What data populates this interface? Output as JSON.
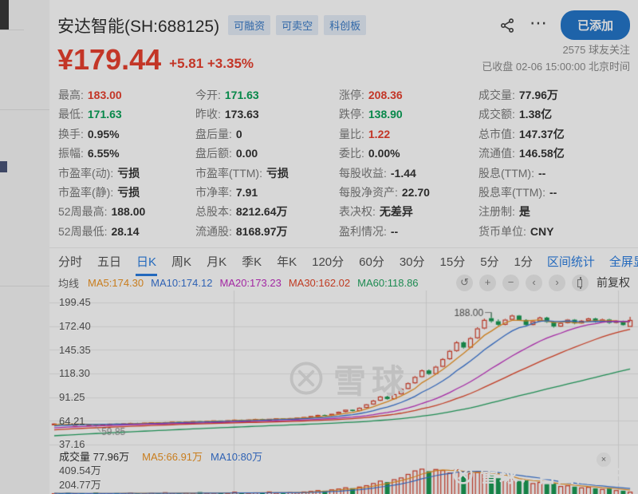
{
  "header": {
    "title": "安达智能(SH:688125)",
    "badges": [
      "可融资",
      "可卖空",
      "科创板"
    ],
    "more_icon": "⋯",
    "added_button": "已添加"
  },
  "quote": {
    "price": "¥179.44",
    "change": "+5.81 +3.35%",
    "followers": "2575 球友关注",
    "status": "已收盘 02-06 15:00:00 北京时间"
  },
  "stats": {
    "columns": [
      [
        {
          "l": "最高:",
          "v": "183.00",
          "c": "red"
        },
        {
          "l": "最低:",
          "v": "171.63",
          "c": "green"
        },
        {
          "l": "换手:",
          "v": "0.95%"
        },
        {
          "l": "振幅:",
          "v": "6.55%"
        },
        {
          "l": "市盈率(动):",
          "v": "亏损"
        },
        {
          "l": "市盈率(静):",
          "v": "亏损"
        },
        {
          "l": "52周最高:",
          "v": "188.00"
        },
        {
          "l": "52周最低:",
          "v": "28.14"
        }
      ],
      [
        {
          "l": "今开:",
          "v": "171.63",
          "c": "green"
        },
        {
          "l": "昨收:",
          "v": "173.63"
        },
        {
          "l": "盘后量:",
          "v": "0"
        },
        {
          "l": "盘后额:",
          "v": "0.00"
        },
        {
          "l": "市盈率(TTM):",
          "v": "亏损"
        },
        {
          "l": "市净率:",
          "v": "7.91"
        },
        {
          "l": "总股本:",
          "v": "8212.64万"
        },
        {
          "l": "流通股:",
          "v": "8168.97万"
        }
      ],
      [
        {
          "l": "涨停:",
          "v": "208.36",
          "c": "red"
        },
        {
          "l": "跌停:",
          "v": "138.90",
          "c": "green"
        },
        {
          "l": "量比:",
          "v": "1.22",
          "c": "red"
        },
        {
          "l": "委比:",
          "v": "0.00%"
        },
        {
          "l": "每股收益:",
          "v": "-1.44"
        },
        {
          "l": "每股净资产:",
          "v": "22.70"
        },
        {
          "l": "表决权:",
          "v": "无差异"
        },
        {
          "l": "盈利情况:",
          "v": "--"
        }
      ],
      [
        {
          "l": "成交量:",
          "v": "77.96万"
        },
        {
          "l": "成交额:",
          "v": "1.38亿"
        },
        {
          "l": "总市值:",
          "v": "147.37亿"
        },
        {
          "l": "流通值:",
          "v": "146.58亿"
        },
        {
          "l": "股息(TTM):",
          "v": "--"
        },
        {
          "l": "股息率(TTM):",
          "v": "--"
        },
        {
          "l": "注册制:",
          "v": "是"
        },
        {
          "l": "货币单位:",
          "v": "CNY"
        }
      ]
    ]
  },
  "tabs": {
    "items": [
      {
        "label": "分时"
      },
      {
        "label": "五日"
      },
      {
        "label": "日K",
        "cls": "active"
      },
      {
        "label": "周K"
      },
      {
        "label": "月K"
      },
      {
        "label": "季K"
      },
      {
        "label": "年K"
      },
      {
        "label": "120分"
      },
      {
        "label": "60分"
      },
      {
        "label": "30分"
      },
      {
        "label": "15分"
      },
      {
        "label": "5分"
      },
      {
        "label": "1分"
      }
    ],
    "links": [
      "区间统计",
      "全屏显示"
    ]
  },
  "toolbar": {
    "ma_title": "均线",
    "ma_items": [
      {
        "text": "MA5:174.30",
        "color": "#ee9524"
      },
      {
        "text": "MA10:174.12",
        "color": "#3875d6"
      },
      {
        "text": "MA20:173.23",
        "color": "#c22fc2"
      },
      {
        "text": "MA30:162.02",
        "color": "#e44629"
      },
      {
        "text": "MA60:118.86",
        "color": "#24a562"
      }
    ],
    "buttons": [
      {
        "name": "undo-icon",
        "glyph": "↺"
      },
      {
        "name": "zoom-in-icon",
        "glyph": "+"
      },
      {
        "name": "zoom-out-icon",
        "glyph": "−"
      },
      {
        "name": "pan-left-icon",
        "glyph": "‹"
      },
      {
        "name": "pan-right-icon",
        "glyph": "›"
      },
      {
        "name": "candle-style-icon",
        "glyph": "",
        "cls": "icon-candle"
      }
    ],
    "adjust": "前复权"
  },
  "watermarks": {
    "center": "雪球",
    "bottom_right": "雪球：自由的张三",
    "close_icon": "×"
  },
  "chart_data": {
    "type": "candlestick",
    "y_tick_labels": [
      "199.45",
      "172.40",
      "145.35",
      "118.30",
      "91.25",
      "64.21",
      "37.16"
    ],
    "y_tick_values": [
      199.45,
      172.4,
      145.35,
      118.3,
      91.25,
      64.21,
      37.16
    ],
    "volume_tick_labels": [
      "409.54万",
      "204.77万"
    ],
    "volume_tick_values": [
      409.54,
      204.77
    ],
    "volume_legend": {
      "title": "成交量 77.96万",
      "ma5": "MA5:66.91万",
      "ma10": "MA10:80万"
    },
    "high_annotation": {
      "text": "188.00",
      "index": 63,
      "value": 188.0
    },
    "low_annotation": {
      "text": "59.85",
      "index": 6,
      "value": 59.85
    },
    "ma_windows": [
      5,
      10,
      20,
      30,
      60
    ],
    "ma_colors": [
      "#ee9524",
      "#3875d6",
      "#c22fc2",
      "#e44629",
      "#24a562"
    ],
    "vol_ma_windows": [
      5,
      10
    ],
    "vol_ma_colors": [
      "#ee9524",
      "#3875d6"
    ],
    "up_color": "#d8402c",
    "down_color": "#1b9b55",
    "grid_color": "#ebebeb",
    "seed": {
      "start": 33.6,
      "end": 60.2,
      "count": 60
    },
    "candles": [
      [
        61.0,
        61.6,
        60.6,
        61.2
      ],
      [
        61.2,
        61.5,
        60.5,
        60.8
      ],
      [
        60.8,
        61.0,
        60.0,
        60.3
      ],
      [
        60.3,
        60.9,
        60.0,
        60.6
      ],
      [
        60.6,
        60.8,
        59.9,
        60.1
      ],
      [
        60.1,
        60.7,
        59.9,
        60.4
      ],
      [
        60.4,
        60.6,
        59.85,
        59.95
      ],
      [
        59.95,
        60.8,
        59.9,
        60.6
      ],
      [
        60.6,
        61.3,
        60.4,
        61.1
      ],
      [
        61.1,
        61.3,
        60.5,
        60.7
      ],
      [
        60.7,
        61.6,
        60.6,
        61.4
      ],
      [
        61.4,
        62.1,
        61.2,
        61.9
      ],
      [
        61.9,
        62.1,
        61.3,
        61.5
      ],
      [
        61.5,
        62.4,
        61.4,
        62.2
      ],
      [
        62.2,
        62.8,
        62.0,
        62.6
      ],
      [
        62.6,
        62.8,
        61.9,
        62.1
      ],
      [
        62.1,
        63.0,
        62.0,
        62.8
      ],
      [
        62.8,
        63.5,
        62.6,
        63.3
      ],
      [
        63.3,
        63.5,
        62.7,
        62.9
      ],
      [
        62.9,
        63.7,
        62.8,
        63.5
      ],
      [
        63.5,
        64.2,
        63.3,
        64.0
      ],
      [
        64.0,
        64.2,
        63.2,
        63.4
      ],
      [
        63.4,
        64.4,
        63.3,
        64.2
      ],
      [
        64.2,
        65.0,
        64.0,
        64.8
      ],
      [
        64.8,
        65.0,
        64.1,
        64.3
      ],
      [
        64.3,
        65.2,
        64.2,
        65.0
      ],
      [
        65.0,
        65.8,
        64.8,
        65.6
      ],
      [
        65.6,
        65.8,
        64.9,
        65.1
      ],
      [
        65.1,
        66.0,
        65.0,
        65.8
      ],
      [
        65.8,
        66.6,
        65.6,
        66.4
      ],
      [
        66.4,
        66.6,
        65.7,
        65.9
      ],
      [
        65.9,
        66.8,
        65.8,
        66.6
      ],
      [
        66.6,
        67.4,
        66.4,
        67.2
      ],
      [
        67.2,
        67.4,
        66.5,
        66.7
      ],
      [
        66.7,
        67.6,
        66.6,
        67.4
      ],
      [
        67.4,
        68.3,
        67.2,
        68.0
      ],
      [
        68.0,
        68.9,
        67.8,
        68.7
      ],
      [
        68.7,
        70.0,
        68.5,
        69.8
      ],
      [
        69.8,
        71.3,
        69.5,
        71.0
      ],
      [
        71.0,
        71.4,
        69.9,
        70.2
      ],
      [
        70.2,
        72.6,
        70.0,
        72.3
      ],
      [
        72.3,
        75.0,
        72.0,
        74.6
      ],
      [
        74.6,
        77.4,
        74.2,
        77.0
      ],
      [
        77.0,
        77.5,
        75.2,
        75.6
      ],
      [
        75.6,
        79.6,
        75.3,
        79.2
      ],
      [
        79.2,
        83.6,
        78.8,
        83.1
      ],
      [
        83.1,
        88.0,
        82.6,
        87.4
      ],
      [
        87.4,
        92.6,
        87.0,
        92.0
      ],
      [
        92.0,
        93.0,
        88.6,
        89.2
      ],
      [
        89.2,
        95.5,
        88.8,
        94.8
      ],
      [
        94.8,
        101.6,
        94.2,
        100.8
      ],
      [
        100.8,
        108.2,
        100.2,
        107.3
      ],
      [
        107.3,
        115.4,
        106.6,
        114.4
      ],
      [
        114.4,
        122.9,
        113.6,
        121.9
      ],
      [
        121.9,
        123.0,
        116.8,
        117.8
      ],
      [
        117.8,
        127.2,
        117.2,
        126.1
      ],
      [
        126.1,
        136.0,
        125.4,
        134.8
      ],
      [
        134.8,
        145.3,
        134.0,
        144.1
      ],
      [
        144.1,
        155.2,
        143.2,
        153.9
      ],
      [
        153.9,
        155.0,
        146.8,
        148.0
      ],
      [
        148.0,
        160.0,
        147.4,
        158.7
      ],
      [
        158.7,
        171.2,
        158.0,
        169.8
      ],
      [
        169.8,
        181.0,
        169.0,
        179.5
      ],
      [
        181.5,
        188.0,
        176.5,
        178.0
      ],
      [
        178.0,
        180.2,
        172.8,
        174.0
      ],
      [
        174.0,
        180.8,
        173.5,
        179.8
      ],
      [
        179.8,
        185.5,
        179.2,
        184.5
      ],
      [
        184.5,
        185.2,
        178.4,
        179.5
      ],
      [
        179.5,
        180.4,
        172.6,
        173.8
      ],
      [
        173.8,
        178.9,
        173.2,
        178.0
      ],
      [
        178.0,
        183.2,
        177.4,
        182.2
      ],
      [
        182.2,
        183.0,
        176.2,
        177.2
      ],
      [
        177.2,
        178.0,
        170.8,
        172.0
      ],
      [
        172.0,
        176.8,
        171.4,
        176.0
      ],
      [
        176.0,
        180.6,
        175.5,
        179.8
      ],
      [
        179.8,
        180.5,
        174.6,
        175.6
      ],
      [
        175.6,
        179.5,
        175.0,
        178.6
      ],
      [
        178.6,
        182.0,
        178.0,
        181.2
      ],
      [
        181.2,
        182.0,
        176.4,
        177.4
      ],
      [
        177.4,
        180.9,
        176.8,
        180.0
      ],
      [
        180.0,
        180.8,
        175.2,
        176.2
      ],
      [
        176.2,
        179.0,
        175.6,
        178.2
      ],
      [
        178.2,
        178.8,
        173.1,
        173.63
      ],
      [
        171.63,
        183.0,
        171.63,
        179.44
      ]
    ],
    "volumes": [
      55,
      48,
      62,
      46,
      57,
      42,
      66,
      51,
      48,
      59,
      51,
      64,
      55,
      48,
      60,
      50,
      70,
      57,
      51,
      62,
      53,
      73,
      59,
      51,
      66,
      55,
      77,
      60,
      53,
      68,
      57,
      80,
      62,
      55,
      71,
      66,
      80,
      88,
      100,
      92,
      110,
      122,
      140,
      128,
      150,
      170,
      200,
      235,
      215,
      255,
      280,
      330,
      380,
      405,
      370,
      400,
      385,
      350,
      395,
      310,
      340,
      360,
      380,
      320,
      270,
      250,
      262,
      230,
      238,
      200,
      215,
      185,
      192,
      158,
      168,
      150,
      138,
      146,
      126,
      116,
      122,
      100,
      92,
      77.96
    ]
  }
}
